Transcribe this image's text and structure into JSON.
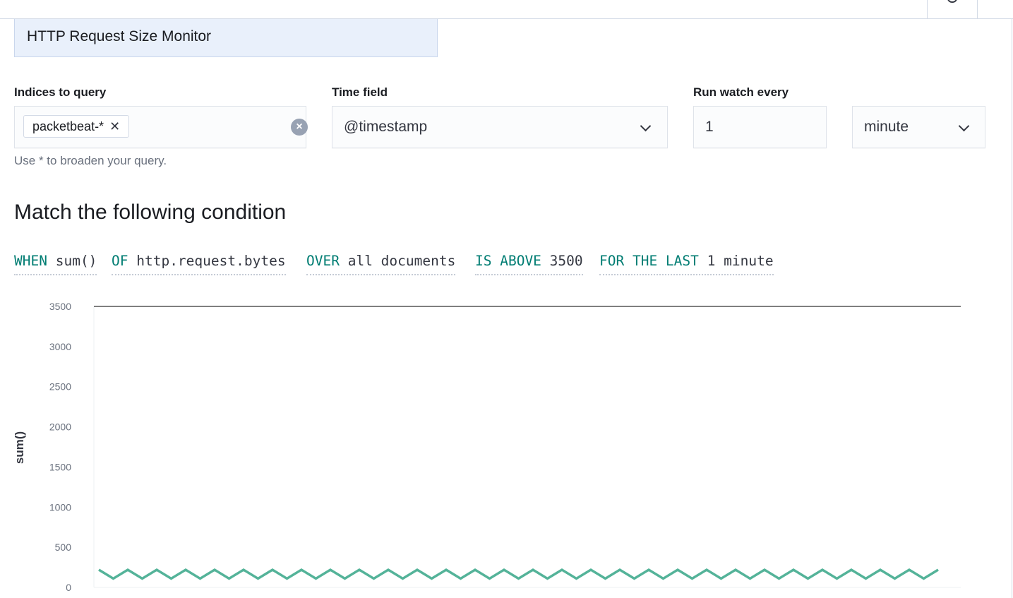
{
  "watch": {
    "name": "HTTP Request Size Monitor"
  },
  "indices": {
    "label": "Indices to query",
    "chip": "packetbeat-*",
    "help": "Use * to broaden your query."
  },
  "time_field": {
    "label": "Time field",
    "value": "@timestamp"
  },
  "schedule": {
    "label": "Run watch every",
    "interval": "1",
    "unit": "minute"
  },
  "condition": {
    "heading": "Match the following condition",
    "tokens": [
      {
        "kw": "WHEN",
        "val": "sum()"
      },
      {
        "kw": "OF",
        "val": "http.request.bytes"
      },
      {
        "kw": "OVER",
        "val": "all documents"
      },
      {
        "kw": "IS ABOVE",
        "val": "3500"
      },
      {
        "kw": "FOR THE LAST",
        "val": "1 minute"
      }
    ]
  },
  "colors": {
    "series": "#54b399",
    "threshold": "#555555",
    "keyword": "#017d73"
  },
  "chart_data": {
    "type": "line",
    "ylabel": "sum()",
    "ylim": [
      0,
      3500
    ],
    "yticks": [
      0,
      500,
      1000,
      1500,
      2000,
      2500,
      3000,
      3500
    ],
    "threshold": 3500,
    "series": [
      {
        "values": [
          220,
          110,
          220,
          110,
          220,
          110,
          220,
          110,
          220,
          110,
          220,
          110,
          220,
          110,
          220,
          110,
          220,
          110,
          220,
          110,
          220,
          110,
          220,
          110,
          220,
          110,
          220,
          110,
          220,
          110,
          220,
          110,
          220,
          110,
          220,
          110,
          220,
          110,
          220,
          110,
          220,
          110,
          220,
          110,
          220,
          110,
          220,
          110,
          220,
          110,
          220,
          110,
          220,
          110,
          220,
          110,
          220,
          110,
          220
        ]
      }
    ]
  }
}
